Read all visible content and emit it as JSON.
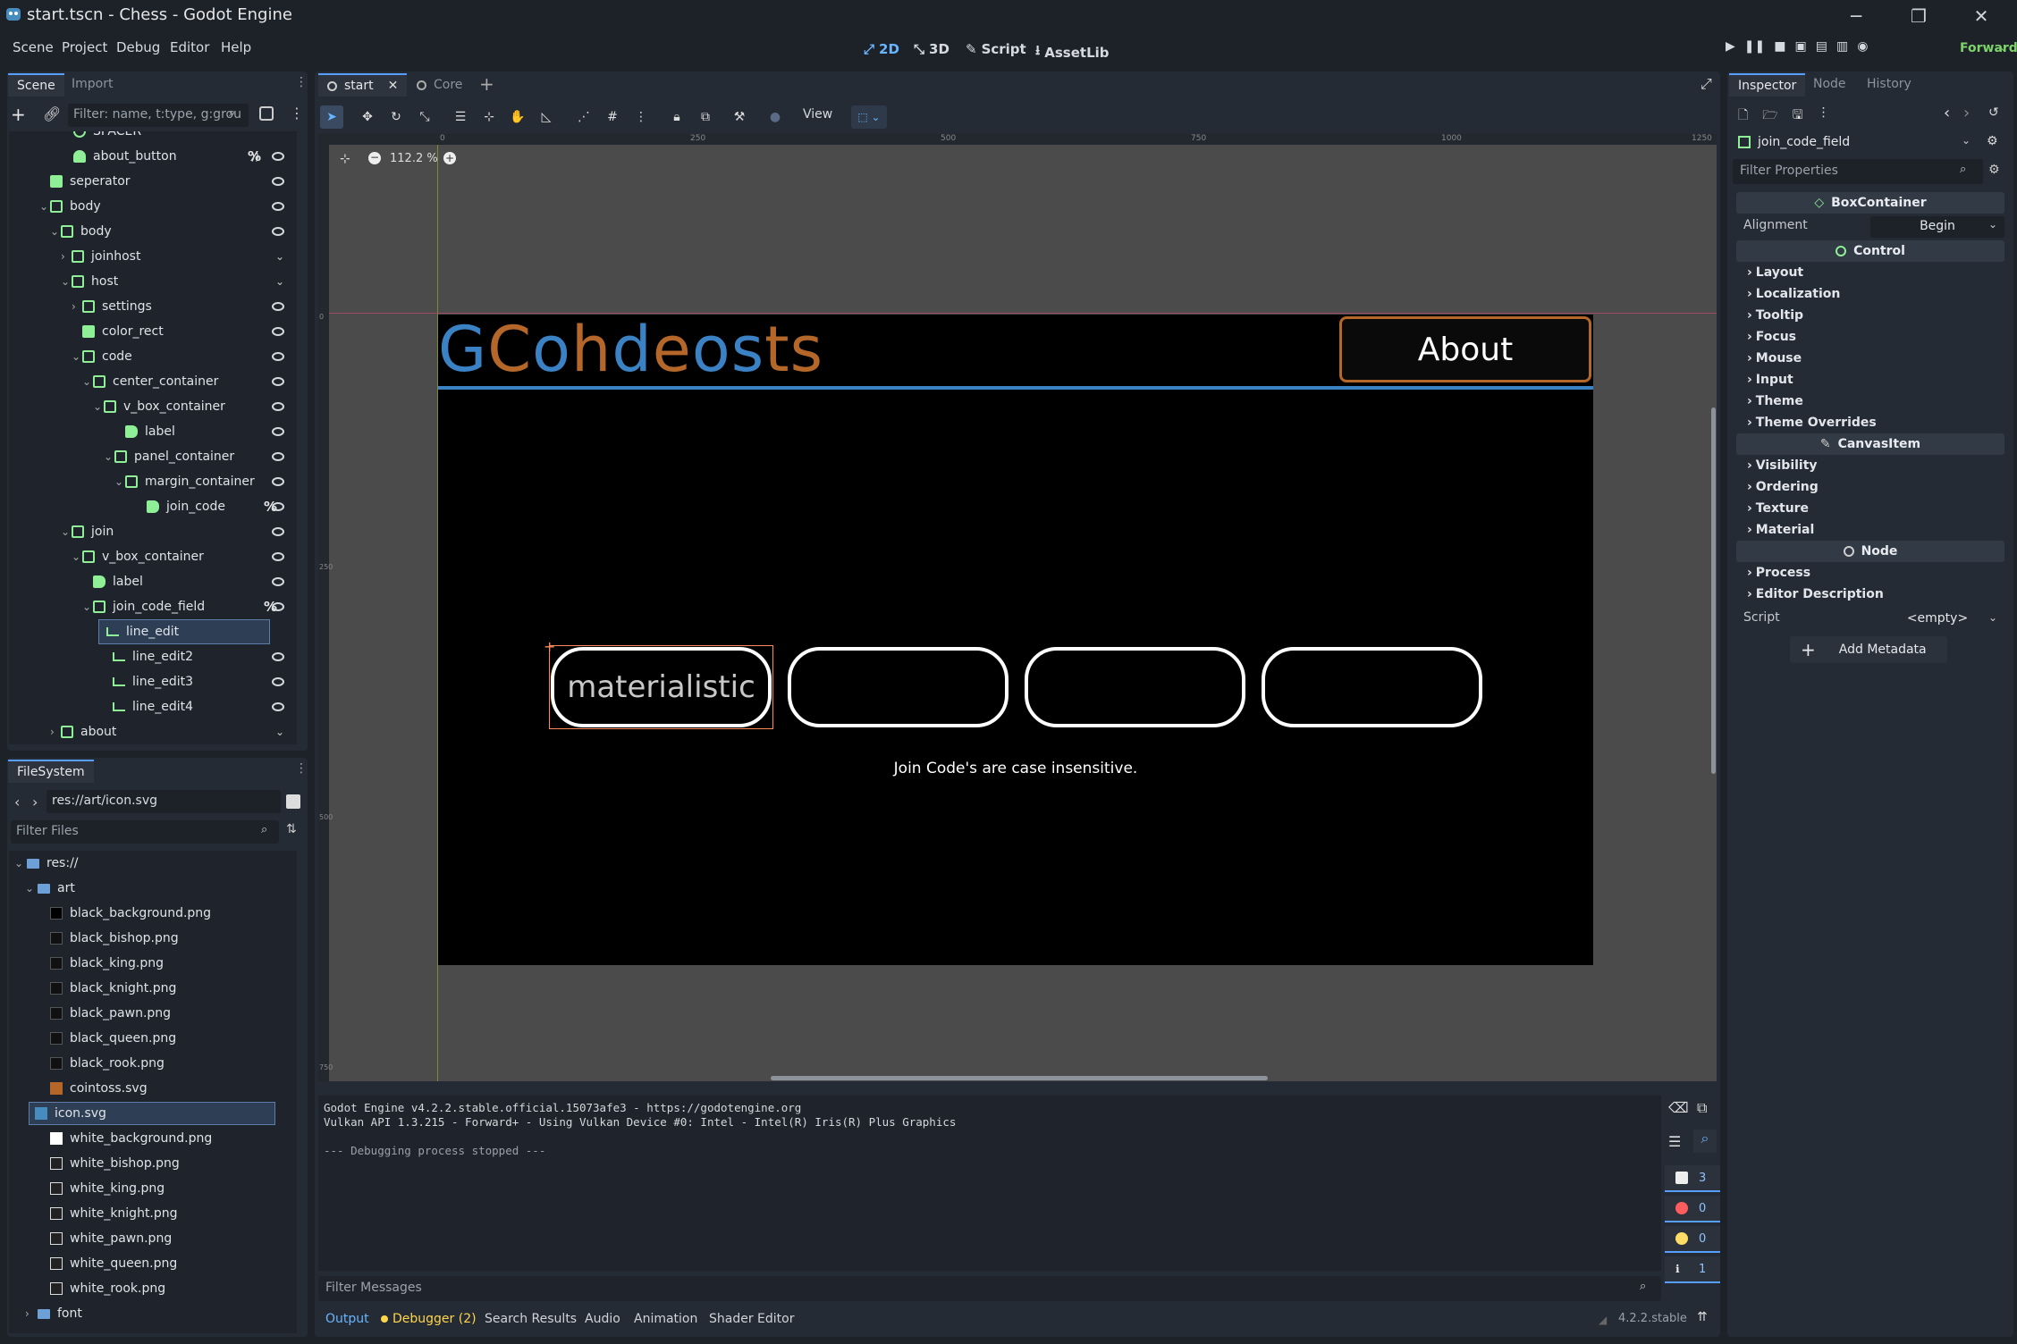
{
  "window": {
    "title": "start.tscn - Chess - Godot Engine",
    "minimize": "─",
    "restore": "❐",
    "close": "✕"
  },
  "menu": [
    "Scene",
    "Project",
    "Debug",
    "Editor",
    "Help"
  ],
  "workspaces": {
    "w2d": "2D",
    "w3d": "3D",
    "script": "Script",
    "assetlib": "AssetLib"
  },
  "renderer": "Forward+",
  "scene_dock": {
    "tabs": [
      "Scene",
      "Import"
    ],
    "filter_placeholder": "Filter: name, t:type, g:grou",
    "nodes": [
      {
        "label": "SPACER"
      },
      {
        "label": "about_button",
        "pct": "%"
      },
      {
        "label": "seperator"
      },
      {
        "label": "body"
      },
      {
        "label": "body"
      },
      {
        "label": "joinhost"
      },
      {
        "label": "host"
      },
      {
        "label": "settings"
      },
      {
        "label": "color_rect"
      },
      {
        "label": "code"
      },
      {
        "label": "center_container"
      },
      {
        "label": "v_box_container"
      },
      {
        "label": "label"
      },
      {
        "label": "panel_container"
      },
      {
        "label": "margin_container"
      },
      {
        "label": "join_code",
        "pct": "%"
      },
      {
        "label": "join"
      },
      {
        "label": "v_box_container"
      },
      {
        "label": "label"
      },
      {
        "label": "join_code_field",
        "pct": "%"
      },
      {
        "label": "line_edit"
      },
      {
        "label": "line_edit2"
      },
      {
        "label": "line_edit3"
      },
      {
        "label": "line_edit4"
      },
      {
        "label": "about"
      }
    ]
  },
  "filesystem": {
    "title": "FileSystem",
    "path": "res://art/icon.svg",
    "filter_placeholder": "Filter Files",
    "items": [
      {
        "label": "res://"
      },
      {
        "label": "art"
      },
      {
        "label": "black_background.png"
      },
      {
        "label": "black_bishop.png"
      },
      {
        "label": "black_king.png"
      },
      {
        "label": "black_knight.png"
      },
      {
        "label": "black_pawn.png"
      },
      {
        "label": "black_queen.png"
      },
      {
        "label": "black_rook.png"
      },
      {
        "label": "cointoss.svg"
      },
      {
        "label": "icon.svg"
      },
      {
        "label": "white_background.png"
      },
      {
        "label": "white_bishop.png"
      },
      {
        "label": "white_king.png"
      },
      {
        "label": "white_knight.png"
      },
      {
        "label": "white_pawn.png"
      },
      {
        "label": "white_queen.png"
      },
      {
        "label": "white_rook.png"
      },
      {
        "label": "font"
      }
    ]
  },
  "scene_tabs": [
    "start",
    "Core"
  ],
  "viewport": {
    "view_menu": "View",
    "zoom": "112.2 %",
    "ruler": [
      "0",
      "250",
      "500",
      "750",
      "1000",
      "1250"
    ],
    "vruler": [
      "0",
      "250",
      "500",
      "750"
    ],
    "logo_letters": [
      {
        "ch": "G",
        "color": "#3b82c4"
      },
      {
        "ch": "C",
        "color": "#b5672a"
      },
      {
        "ch": "o",
        "color": "#3b82c4"
      },
      {
        "ch": "h",
        "color": "#b5672a"
      },
      {
        "ch": "d",
        "color": "#3b82c4"
      },
      {
        "ch": "e",
        "color": "#b5672a"
      },
      {
        "ch": "o",
        "color": "#3b82c4"
      },
      {
        "ch": "s",
        "color": "#3b82c4"
      },
      {
        "ch": "t",
        "color": "#b5672a"
      },
      {
        "ch": "s",
        "color": "#b5672a"
      }
    ],
    "about_button": "About",
    "join_label": "Join Code's are case insensitive.",
    "line_edits": [
      "materialistic",
      "",
      "",
      ""
    ]
  },
  "output": {
    "lines": [
      "Godot Engine v4.2.2.stable.official.15073afe3 - https://godotengine.org",
      "Vulkan API 1.3.215 - Forward+ - Using Vulkan Device #0: Intel - Intel(R) Iris(R) Plus Graphics",
      "",
      "--- Debugging process stopped ---"
    ],
    "filter_placeholder": "Filter Messages",
    "counts": [
      "3",
      "0",
      "0",
      "1"
    ]
  },
  "bottom_tabs": [
    "Output",
    "Debugger (2)",
    "Search Results",
    "Audio",
    "Animation",
    "Shader Editor"
  ],
  "version": "4.2.2.stable",
  "inspector": {
    "tabs": [
      "Inspector",
      "Node",
      "History"
    ],
    "node_name": "join_code_field",
    "filter_placeholder": "Filter Properties",
    "section_box": "BoxContainer",
    "alignment_label": "Alignment",
    "alignment_value": "Begin",
    "section_control": "Control",
    "control_cats": [
      "Layout",
      "Localization",
      "Tooltip",
      "Focus",
      "Mouse",
      "Input",
      "Theme",
      "Theme Overrides"
    ],
    "section_canvas": "CanvasItem",
    "canvas_cats": [
      "Visibility",
      "Ordering",
      "Texture",
      "Material"
    ],
    "section_node": "Node",
    "node_cats": [
      "Process",
      "Editor Description"
    ],
    "script_label": "Script",
    "script_value": "<empty>",
    "add_metadata": "Add Metadata"
  },
  "colors": {
    "accent": "#569eff",
    "node_green": "#8eef97",
    "logo_blue": "#3b82c4",
    "logo_orange": "#b5672a",
    "selection": "#ff8a5b"
  }
}
